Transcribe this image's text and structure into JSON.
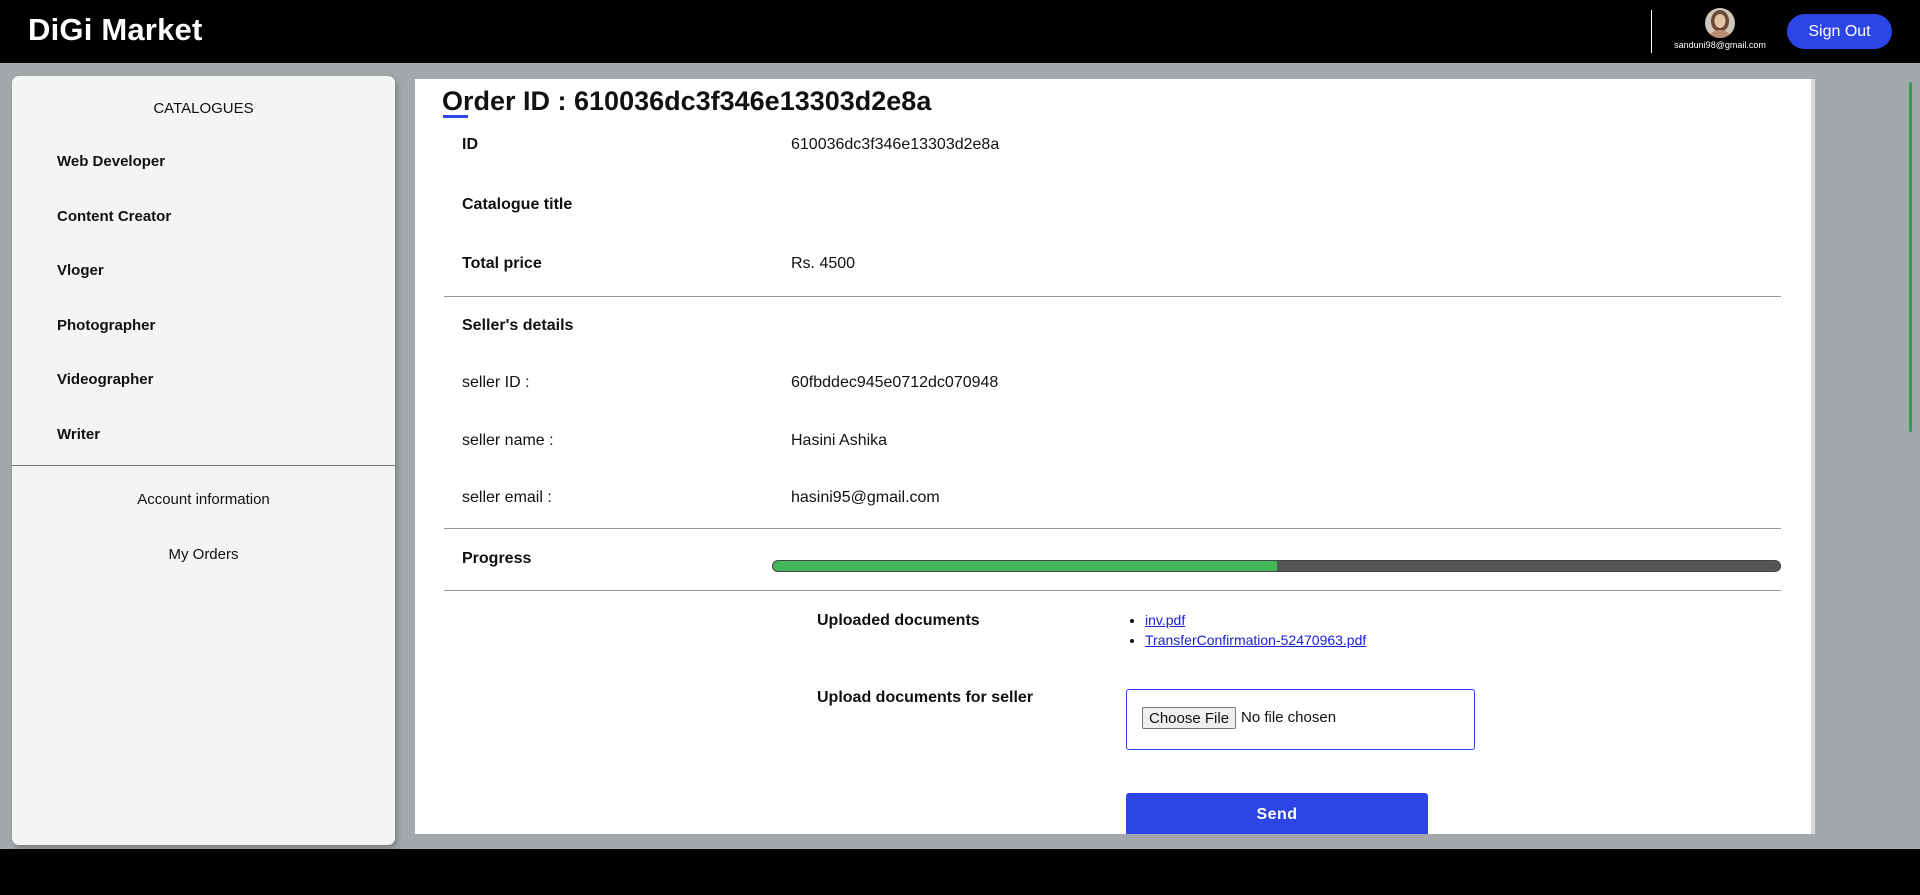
{
  "header": {
    "brand": "DiGi Market",
    "user_email": "sanduni98@gmail.com",
    "signout_label": "Sign Out"
  },
  "sidebar": {
    "catalogues_title": "CATALOGUES",
    "categories": [
      "Web Developer",
      "Content Creator",
      "Vloger",
      "Photographer",
      "Videographer",
      "Writer"
    ],
    "account_info_label": "Account information",
    "my_orders_label": "My Orders"
  },
  "order": {
    "title": "Order ID : 610036dc3f346e13303d2e8a",
    "id_label": "ID",
    "id_value": "610036dc3f346e13303d2e8a",
    "catalogue_title_label": "Catalogue title",
    "catalogue_title_value": "",
    "total_price_label": "Total price",
    "total_price_value": "Rs. 4500",
    "sellers_details_label": "Seller's details",
    "seller_id_label": "seller ID :",
    "seller_id_value": "60fbddec945e0712dc070948",
    "seller_name_label": "seller name :",
    "seller_name_value": "Hasini Ashika",
    "seller_email_label": "seller email :",
    "seller_email_value": "hasini95@gmail.com",
    "progress_label": "Progress",
    "progress_fraction": 0.5
  },
  "documents": {
    "uploaded_label": "Uploaded documents",
    "files": [
      "inv.pdf",
      "TransferConfirmation-52470963.pdf"
    ],
    "upload_label": "Upload documents for seller",
    "choose_file_label": "Choose File",
    "no_file_text": "No file chosen",
    "send_label": "Send"
  },
  "colors": {
    "accent": "#2d45e6",
    "progress": "#43b85a",
    "header_bg": "#000000"
  }
}
